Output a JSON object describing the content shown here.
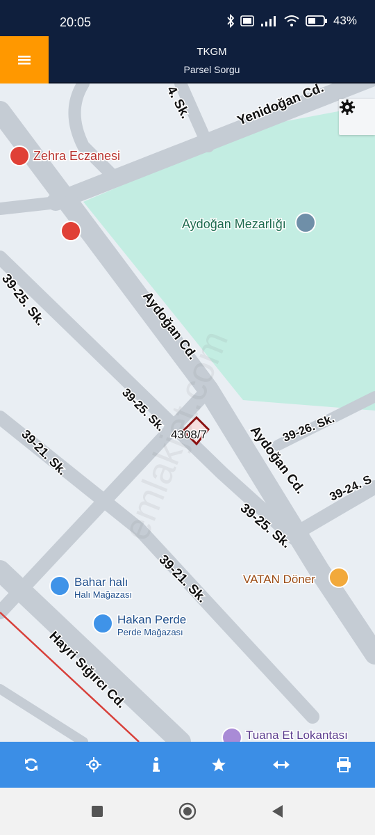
{
  "status_bar": {
    "time": "20:05",
    "battery": "43%",
    "icons": [
      "bluetooth-icon",
      "volte-icon",
      "signal-icon",
      "wifi-icon",
      "battery-icon"
    ]
  },
  "header": {
    "title": "TKGM",
    "subtitle": "Parsel Sorgu",
    "menu_icon": "hamburger-menu-icon",
    "accent_color": "#ff9800",
    "bar_color": "#0f1f3d"
  },
  "map": {
    "parcel_label": "4308/7",
    "streets": {
      "yenidogan": "Yenidoğan Cd.",
      "sk4": "4. Sk.",
      "aydogan_cd_upper": "Aydoğan Cd.",
      "aydogan_cd_lower": "Aydoğan Cd.",
      "sk_39_25_a": "39-25. Sk.",
      "sk_39_25_b": "39-25. Sk.",
      "sk_39_25_c": "39-25. Sk.",
      "sk_39_26": "39-26. Sk.",
      "sk_39_24": "39-24. S",
      "sk_39_21_a": "39-21. Sk.",
      "sk_39_21_b": "39-21. Sk.",
      "hayri_sigirci": "Hayri Sığırcı Cd."
    },
    "pois": {
      "zehra_eczanesi": "Zehra Eczanesi",
      "aydogan_mezarligi": "Aydoğan Mezarlığı",
      "vatan_doner": "VATAN Döner",
      "bahar_hali": "Bahar halı",
      "bahar_hali_sub": "Halı Mağazası",
      "hakan_perde": "Hakan Perde",
      "hakan_perde_sub": "Perde Mağazası",
      "tuana_et": "Tuana Et Lokantası"
    },
    "watermark": "emlakjet.com",
    "settings_icon": "gear-icon"
  },
  "toolbar": {
    "buttons": [
      {
        "name": "refresh-button",
        "icon": "refresh-icon"
      },
      {
        "name": "locate-button",
        "icon": "crosshair-icon"
      },
      {
        "name": "info-button",
        "icon": "info-icon"
      },
      {
        "name": "favorite-button",
        "icon": "star-icon"
      },
      {
        "name": "measure-button",
        "icon": "horizontal-arrows-icon"
      },
      {
        "name": "print-button",
        "icon": "printer-icon"
      }
    ],
    "color": "#3b8ee6"
  },
  "nav": {
    "buttons": [
      "recent-apps-icon",
      "home-icon",
      "back-icon"
    ]
  }
}
